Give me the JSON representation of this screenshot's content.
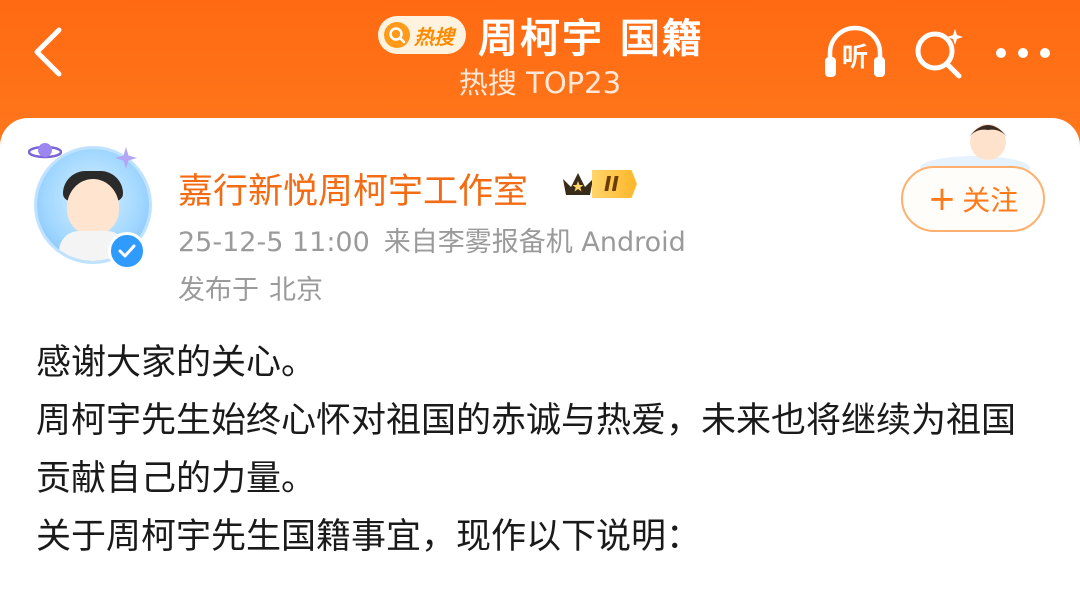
{
  "header": {
    "hot_badge_label": "热搜",
    "topic_title": "周柯宇 国籍",
    "rank_label": "热搜 TOP23",
    "listen_label": "听",
    "colors": {
      "header_top": "#ff6a12",
      "header_bottom": "#ffb060",
      "accent": "#ff7a1a"
    },
    "icons": [
      "back-arrow-icon",
      "search-hot-icon",
      "listen-icon",
      "search-sparkle-icon",
      "more-dots-icon"
    ]
  },
  "post": {
    "author_name": "嘉行新悦周柯宇工作室",
    "vip_level": "II",
    "timestamp": "25-12-5 11:00",
    "source": "来自李雾报备机 Android",
    "location_prefix": "发布于",
    "location": "北京",
    "follow_plus": "+",
    "follow_label": "关注",
    "paragraphs": [
      "感谢大家的关心。",
      "周柯宇先生始终心怀对祖国的赤诚与热爱，未来也将继续为祖国贡献自己的力量。",
      "关于周柯宇先生国籍事宜，现作以下说明："
    ],
    "colors": {
      "author_name": "#f36b12",
      "meta_text": "#9a9a9a",
      "body_text": "#1a1a1a",
      "verified": "#2f9bff"
    }
  }
}
